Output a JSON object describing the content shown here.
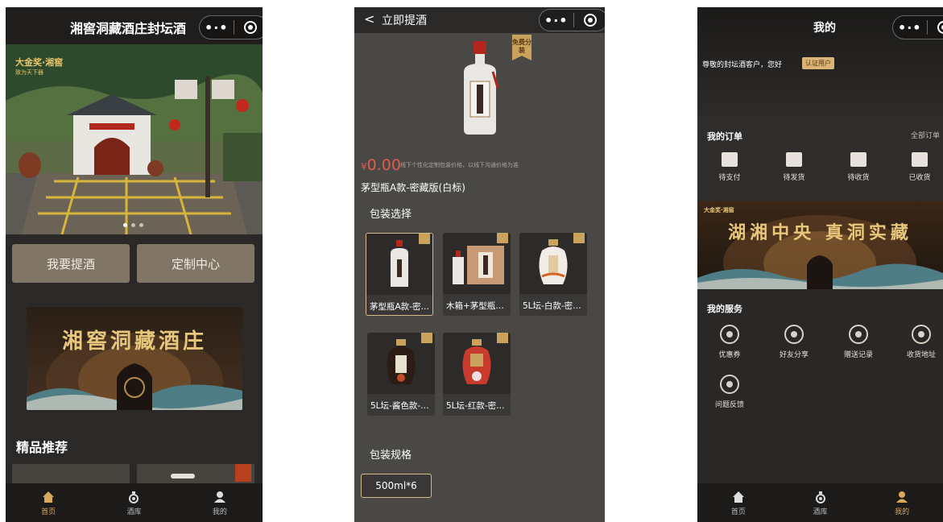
{
  "capsule": {
    "more_label": "•·•"
  },
  "home": {
    "title": "湘窖洞藏酒庄封坛酒",
    "hero": {
      "badge": "大金奖·湘窖",
      "badge_sub": "致为天下器"
    },
    "buttons": {
      "take_wine": "我要提酒",
      "customize": "定制中心"
    },
    "banner_text": "湘窖洞藏酒庄",
    "recommend_title": "精品推荐",
    "tabs": [
      {
        "label": "首页",
        "icon": "home-icon",
        "active": true
      },
      {
        "label": "酒库",
        "icon": "wine-cellar-icon",
        "active": false
      },
      {
        "label": "我的",
        "icon": "user-icon",
        "active": false
      }
    ]
  },
  "pickup": {
    "back_label": "<",
    "title": "立即提酒",
    "free_tag": "免费分装",
    "price_currency": "¥",
    "price_value": "0.00",
    "price_note": "线下个性化定制包装价格，以线下沟通价格为准",
    "product_name": "茅型瓶A款-密藏版(白标)",
    "packaging_title": "包装选择",
    "options": [
      {
        "label": "茅型瓶A款-密…",
        "selected": true
      },
      {
        "label": "木箱+茅型瓶…",
        "selected": false
      },
      {
        "label": "5L坛-白款-密…",
        "selected": false
      },
      {
        "label": "5L坛-酱色款-…",
        "selected": false
      },
      {
        "label": "5L坛-红款-密…",
        "selected": false
      }
    ],
    "spec_title": "包装规格",
    "spec_value": "500ml*6"
  },
  "mine": {
    "title": "我的",
    "greeting": "尊敬的封坛酒客户，您好",
    "cert_badge": "认证用户",
    "orders_title": "我的订单",
    "all_orders": "全部订单",
    "order_items": [
      {
        "label": "待支付",
        "icon": "wallet-icon"
      },
      {
        "label": "待发货",
        "icon": "package-icon"
      },
      {
        "label": "待收货",
        "icon": "truck-icon"
      },
      {
        "label": "已收货",
        "icon": "box-check-icon"
      }
    ],
    "banner_brand": "大金奖·湘窖",
    "banner_text": "湖湘中央 真洞实藏",
    "services_title": "我的服务",
    "services": [
      {
        "label": "优惠券",
        "icon": "coupon-icon"
      },
      {
        "label": "好友分享",
        "icon": "share-icon"
      },
      {
        "label": "赠送记录",
        "icon": "gift-record-icon"
      },
      {
        "label": "收货地址",
        "icon": "location-icon"
      },
      {
        "label": "问题反馈",
        "icon": "feedback-icon"
      }
    ],
    "tabs": [
      {
        "label": "首页",
        "icon": "home-icon",
        "active": false
      },
      {
        "label": "酒库",
        "icon": "wine-cellar-icon",
        "active": false
      },
      {
        "label": "我的",
        "icon": "user-icon",
        "active": true
      }
    ]
  },
  "colors": {
    "accent_gold": "#d9a85a",
    "button_bg": "#817566",
    "price_red": "#e05a4d"
  }
}
